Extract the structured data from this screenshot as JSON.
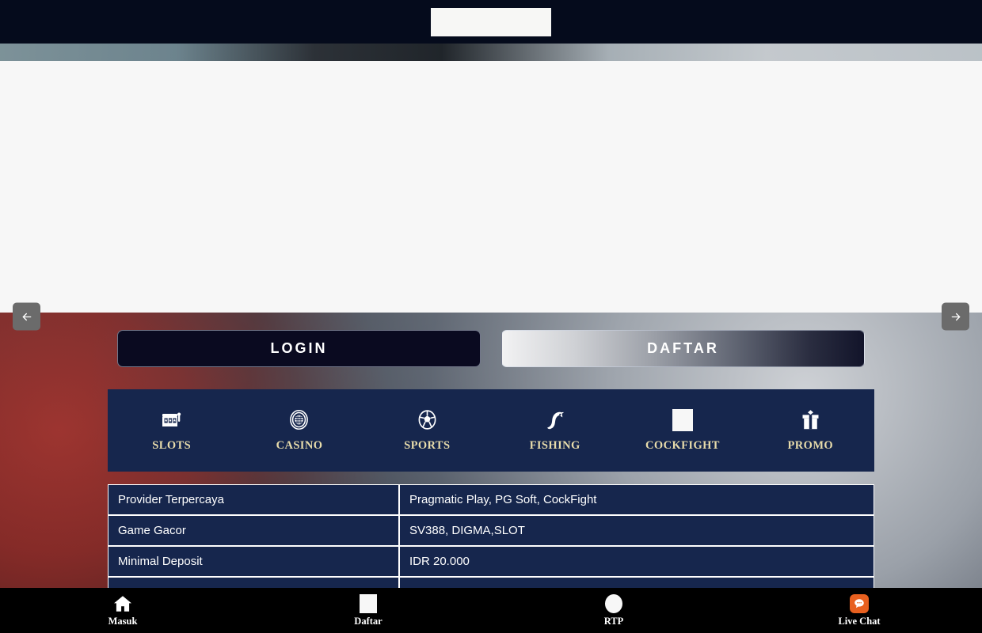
{
  "header": {
    "logo_alt": "site-logo",
    "background_color": "#050b1c"
  },
  "carousel": {
    "prev_label": "prev-slide",
    "next_label": "next-slide",
    "slide_alt": "promo-banner"
  },
  "auth": {
    "login_label": "LOGIN",
    "register_label": "DAFTAR"
  },
  "categories": {
    "accent_color": "#e8dcab",
    "panel_color": "#16264d",
    "items": [
      {
        "label": "SLOTS",
        "icon": "slot-machine-icon"
      },
      {
        "label": "CASINO",
        "icon": "casino-chip-icon"
      },
      {
        "label": "SPORTS",
        "icon": "soccer-ball-icon"
      },
      {
        "label": "FISHING",
        "icon": "fish-icon"
      },
      {
        "label": "COCKFIGHT",
        "icon": "broken-image-icon"
      },
      {
        "label": "PROMO",
        "icon": "gift-box-icon"
      }
    ]
  },
  "info_table": {
    "rows": [
      {
        "key": "Provider Terpercaya",
        "value": "Pragmatic Play, PG Soft, CockFight"
      },
      {
        "key": "Game Gacor",
        "value": "SV388, DIGMA,SLOT"
      },
      {
        "key": "Minimal Deposit",
        "value": "IDR 20.000"
      },
      {
        "key": "",
        "value": ""
      }
    ]
  },
  "bottom_nav": {
    "items": [
      {
        "label": "Masuk",
        "icon": "home-icon"
      },
      {
        "label": "Daftar",
        "icon": "broken-image-icon"
      },
      {
        "label": "RTP",
        "icon": "circle-icon"
      },
      {
        "label": "Live Chat",
        "icon": "chat-bubble-icon"
      }
    ],
    "chat_color": "#e8601f"
  }
}
